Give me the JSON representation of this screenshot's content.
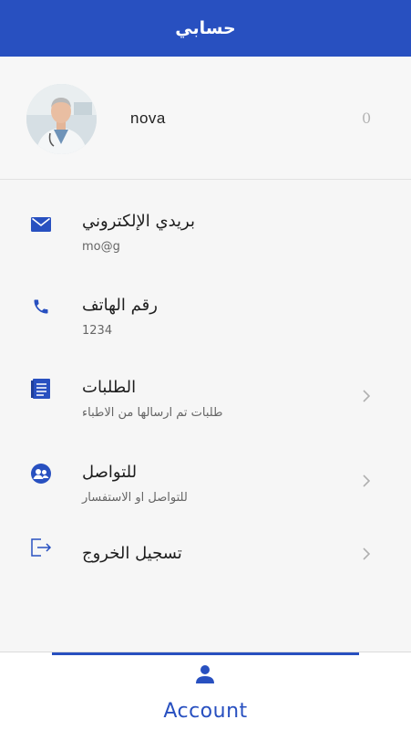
{
  "header": {
    "title": "حسابي"
  },
  "profile": {
    "name": "nova",
    "count": "0",
    "avatar_icon": "doctor-avatar-photo"
  },
  "menu": {
    "email": {
      "title": "بريدي الإلكتروني",
      "subtitle": "mo@g",
      "icon": "mail-icon"
    },
    "phone": {
      "title": "رقم الهاتف",
      "subtitle": "1234",
      "icon": "phone-icon"
    },
    "requests": {
      "title": "الطلبات",
      "subtitle": "طلبات تم ارسالها من الاطباء",
      "icon": "book-icon"
    },
    "contact": {
      "title": "للتواصل",
      "subtitle": "للتواصل او الاستفسار",
      "icon": "contacts-icon"
    },
    "logout": {
      "title": "تسجيل الخروج",
      "icon": "logout-icon"
    }
  },
  "bottom_nav": {
    "label": "Account",
    "icon": "person-icon"
  },
  "colors": {
    "primary": "#2850c0",
    "background": "#f6f6f6"
  }
}
